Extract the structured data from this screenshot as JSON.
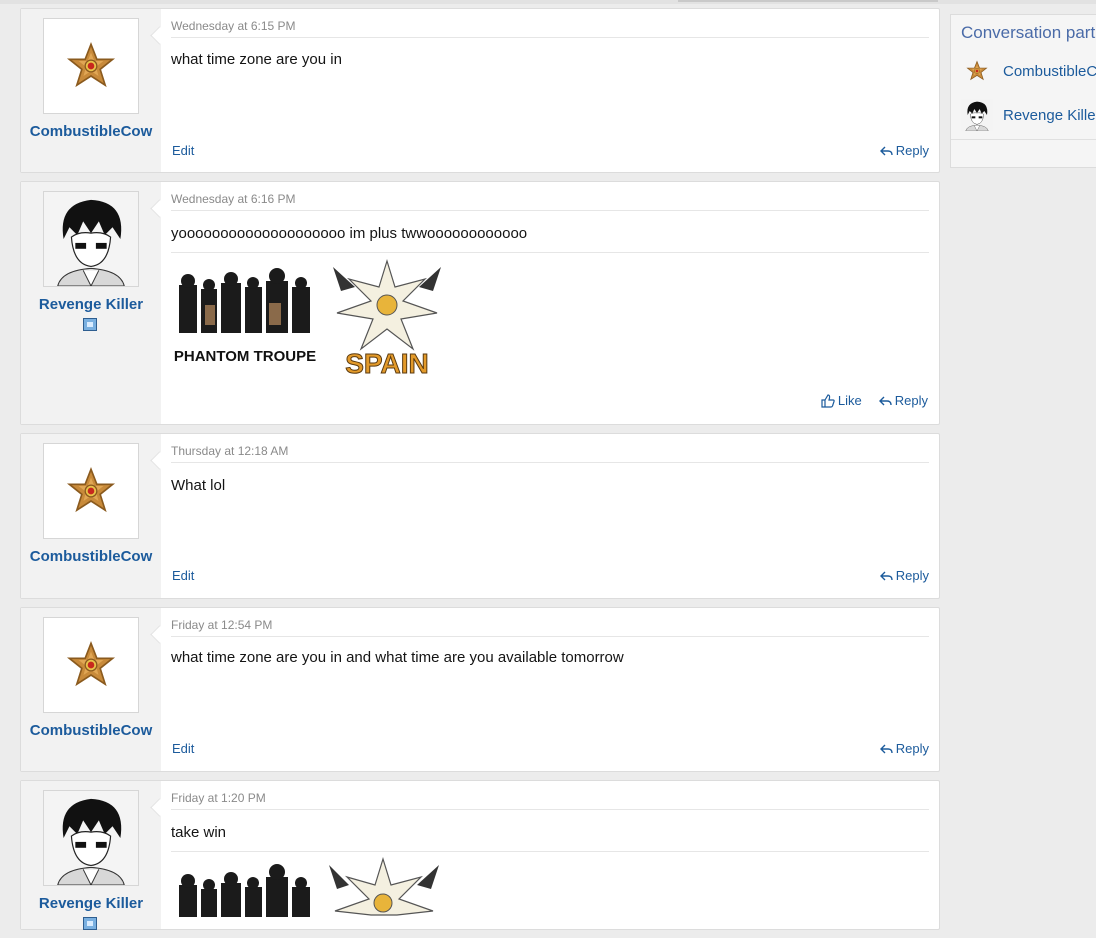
{
  "sidebar": {
    "title": "Conversation parti",
    "participants": [
      {
        "name": "CombustibleC",
        "avatar": "staryu-icon"
      },
      {
        "name": "Revenge Killer",
        "avatar": "anime-boy-icon"
      }
    ]
  },
  "messages": [
    {
      "user": "CombustibleCow",
      "avatar": "staryu-icon",
      "date": "Wednesday at 6:15 PM",
      "text": "what time zone are you in",
      "edit": "Edit",
      "reply": "Reply"
    },
    {
      "user": "Revenge Killer",
      "avatar": "anime-boy-icon",
      "date": "Wednesday at 6:16 PM",
      "text": "yoooooooooooooooooooo im plus twwoooooooooooo",
      "signature": [
        "PHANTOM TROUPE",
        "SPAIN"
      ],
      "like": "Like",
      "reply": "Reply"
    },
    {
      "user": "CombustibleCow",
      "avatar": "staryu-icon",
      "date": "Thursday at 12:18 AM",
      "text": "What lol",
      "edit": "Edit",
      "reply": "Reply"
    },
    {
      "user": "CombustibleCow",
      "avatar": "staryu-icon",
      "date": "Friday at 12:54 PM",
      "text": "what time zone are you in and what time are you available tomorrow",
      "edit": "Edit",
      "reply": "Reply"
    },
    {
      "user": "Revenge Killer",
      "avatar": "anime-boy-icon",
      "date": "Friday at 1:20 PM",
      "text": "take win"
    }
  ],
  "colors": {
    "link": "#1c5b9c",
    "date": "#8a8a8a",
    "sidebar_title": "#4a6ba8"
  }
}
